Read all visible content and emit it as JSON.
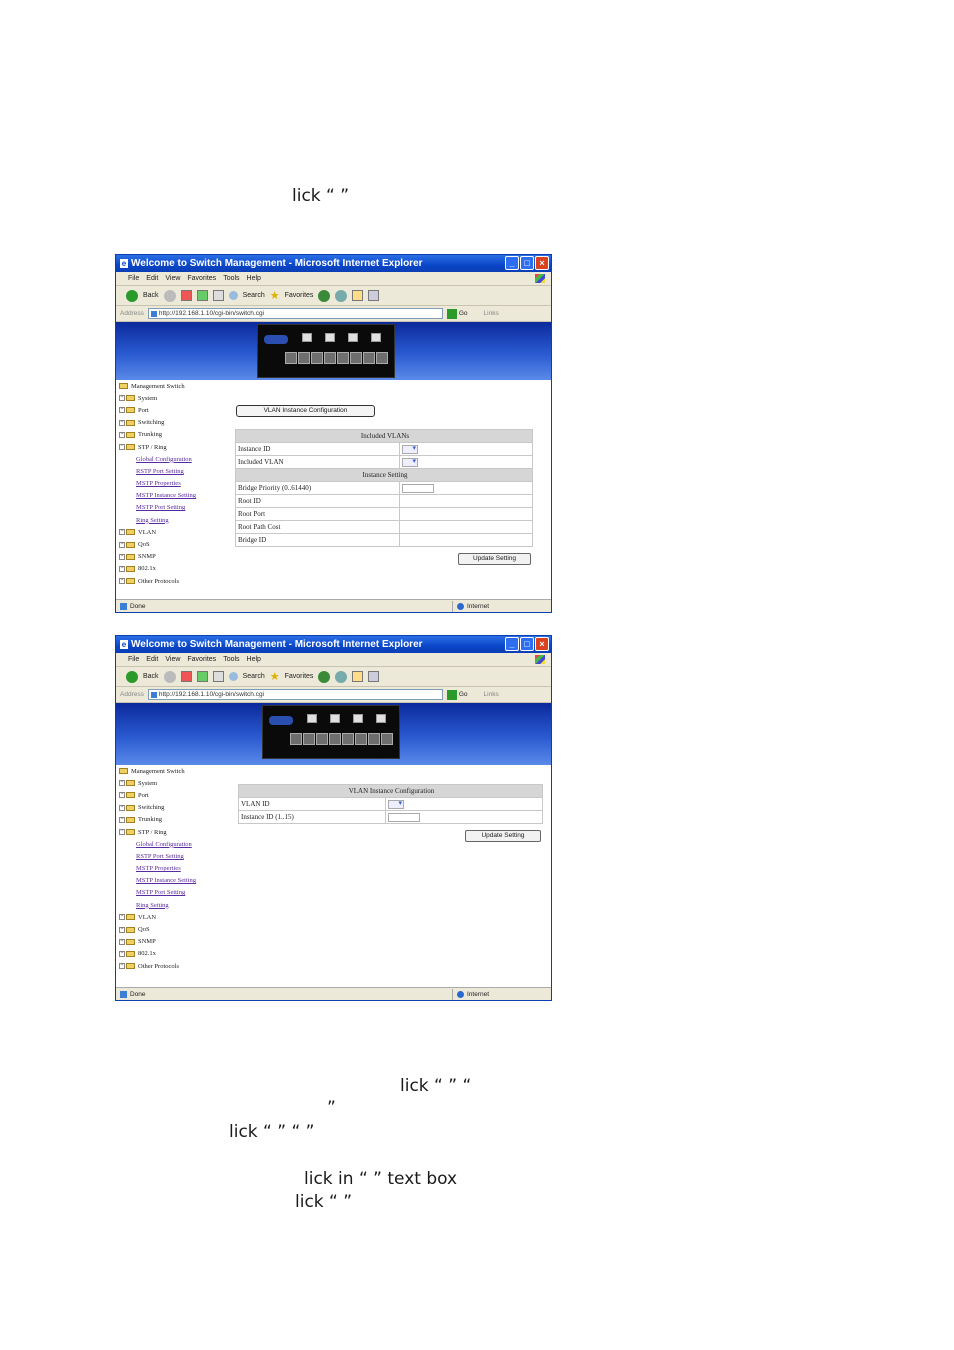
{
  "text_fragments": {
    "f1": "lick “                       ”",
    "f2": "lick “                                            ”                    “",
    "f3": "”",
    "f4": "lick “            ”                                                        “           ”",
    "f5": "lick in “                  ” text box",
    "f6": "lick  “                        ”"
  },
  "browser": {
    "title": "Welcome to Switch Management - Microsoft Internet Explorer",
    "menu": [
      "File",
      "Edit",
      "View",
      "Favorites",
      "Tools",
      "Help"
    ],
    "toolbar": {
      "back": "Back",
      "search": "Search",
      "favorites": "Favorites"
    },
    "address_label": "Address",
    "url": "http://192.168.1.10/cgi-bin/switch.cgi",
    "go": "Go",
    "links": "Links",
    "status_left": "Done",
    "status_zone": "Internet"
  },
  "tree": {
    "root": "Management Switch",
    "folders_top": [
      "System",
      "Port",
      "Switching",
      "Trunking",
      "STP / Ring"
    ],
    "stp_links": [
      "Global Configuration",
      "RSTP Port Setting",
      "MSTP Properties",
      "MSTP Instance Setting",
      "MSTP Port Setting",
      "Ring Setting"
    ],
    "folders_bottom": [
      "VLAN",
      "QoS",
      "SNMP",
      "802.1x",
      "Other Protocols"
    ]
  },
  "screen1": {
    "button": "VLAN Instance Configuration",
    "header_included": "Included VLANs",
    "rows_included": [
      "Instance ID",
      "Included VLAN"
    ],
    "header_setting": "Instance Setting",
    "rows_setting": [
      "Bridge Priority (0..61440)",
      "Root ID",
      "Root Port",
      "Root Path Cost",
      "Bridge ID"
    ],
    "update": "Update Setting"
  },
  "screen2": {
    "header": "VLAN Instance Configuration",
    "rows": [
      "VLAN ID",
      "Instance ID (1..15)"
    ],
    "update": "Update Setting"
  },
  "icons": [
    "ie-icon",
    "minimize-icon",
    "maximize-icon",
    "close-icon",
    "back-icon",
    "forward-icon",
    "stop-icon",
    "refresh-icon",
    "home-icon",
    "search-icon",
    "favorites-icon",
    "media-icon",
    "history-icon",
    "mail-icon",
    "print-icon",
    "go-icon",
    "folder-icon",
    "globe-icon"
  ]
}
